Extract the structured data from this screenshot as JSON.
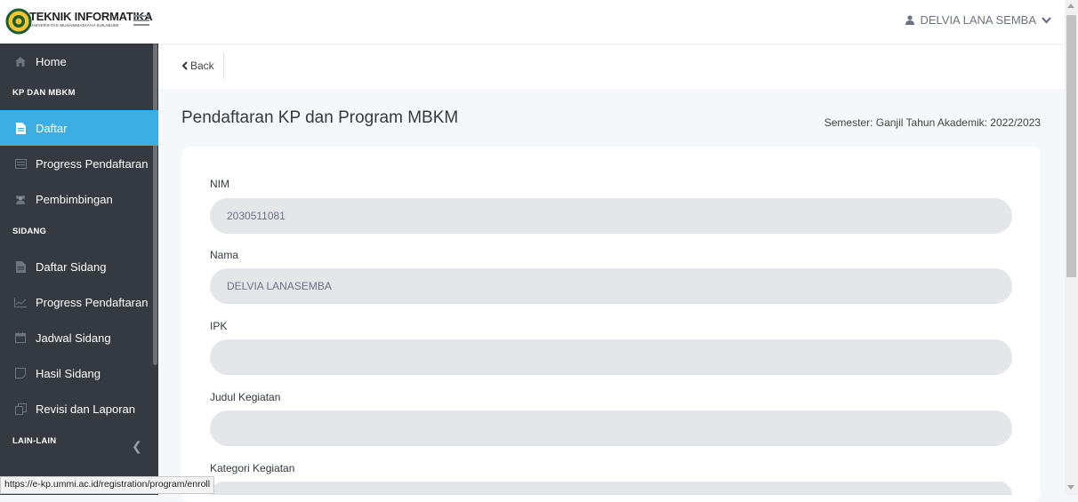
{
  "header": {
    "logo_title": "TEKNIK INFORMATIKA",
    "logo_subtitle": "UNIVERSITAS MUHAMMADIYAH SUKABUMI",
    "user_name": "DELVIA LANA SEMBA"
  },
  "sidebar": {
    "home": "Home",
    "section_kp": "KP DAN MBKM",
    "daftar": "Daftar",
    "progress_pendaftaran": "Progress Pendaftaran",
    "pembimbingan": "Pembimbingan",
    "section_sidang": "SIDANG",
    "daftar_sidang": "Daftar Sidang",
    "progress_pendaftaran_2": "Progress Pendaftaran",
    "jadwal_sidang": "Jadwal Sidang",
    "hasil_sidang": "Hasil Sidang",
    "revisi_laporan": "Revisi dan Laporan",
    "section_lain": "LAIN-LAIN"
  },
  "nav": {
    "back_label": "Back"
  },
  "page": {
    "title": "Pendaftaran KP dan Program MBKM",
    "semester": "Semester: Ganjil Tahun Akademik: 2022/2023"
  },
  "form": {
    "nim_label": "NIM",
    "nim_value": "2030511081",
    "nama_label": "Nama",
    "nama_value": "DELVIA LANASEMBA",
    "ipk_label": "IPK",
    "ipk_value": "",
    "judul_label": "Judul Kegiatan",
    "judul_value": "",
    "kategori_label": "Kategori Kegiatan"
  },
  "status_url": "https://e-kp.ummi.ac.id/registration/program/enroll",
  "colors": {
    "sidebar_bg": "#343a40",
    "active": "#3caee3",
    "input_bg": "#e4e6ea"
  }
}
